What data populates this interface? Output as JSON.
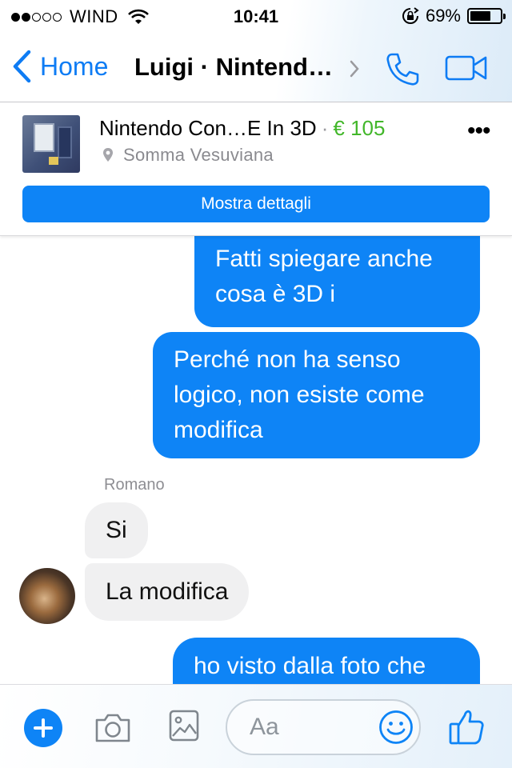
{
  "status": {
    "carrier": "WIND",
    "time": "10:41",
    "battery_percent": "69%",
    "battery_level": 0.69,
    "signal_bars_filled": 2,
    "signal_bars_total": 5
  },
  "nav": {
    "back_label": "Home",
    "title": "Luigi · Nintend…",
    "accent_color": "#0e7cf4"
  },
  "listing": {
    "title": "Nintendo  Con…E In 3D",
    "separator": "·",
    "price": "€ 105",
    "price_color": "#42b72a",
    "location": "Somma Vesuviana",
    "details_button": "Mostra dettagli",
    "more_label": "•••"
  },
  "messages": [
    {
      "direction": "out",
      "text": "Fatti spiegare anche cosa è 3D i"
    },
    {
      "direction": "out",
      "text": "Perché non ha senso logico, non esiste come modifica"
    },
    {
      "direction": "in",
      "text": "Si"
    },
    {
      "direction": "in",
      "text": "La modifica"
    },
    {
      "direction": "out",
      "text": "ho visto dalla foto che"
    }
  ],
  "incoming_sender": "Romano",
  "composer": {
    "placeholder": "Aa",
    "icons": [
      "plus-icon",
      "camera-icon",
      "gallery-icon",
      "smile-icon",
      "like-icon"
    ]
  },
  "colors": {
    "outgoing_bubble": "#0e84f6",
    "incoming_bubble": "#f0f0f1"
  }
}
